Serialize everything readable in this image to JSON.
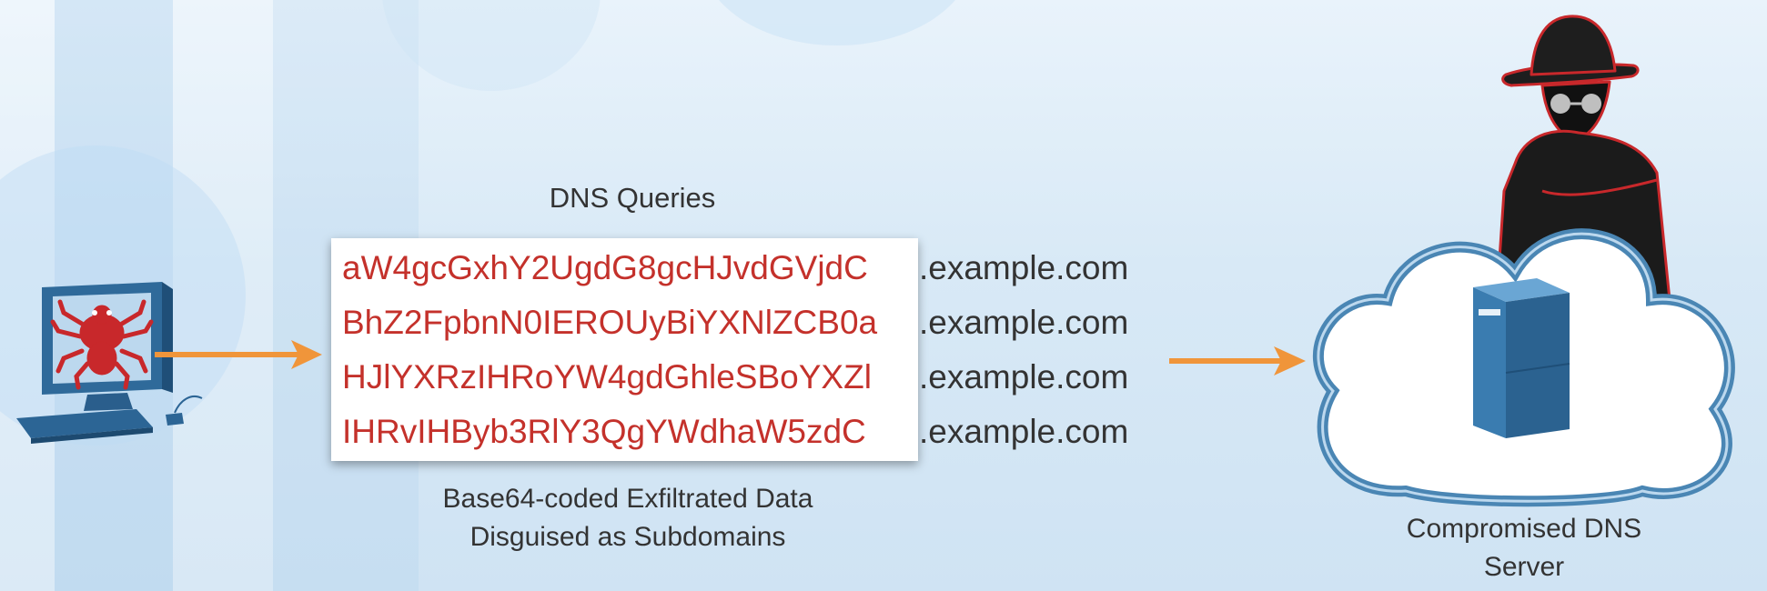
{
  "queries_title": "DNS Queries",
  "queries": [
    {
      "subdomain": "aW4gcGxhY2UgdG8gcHJvdGVjdC",
      "domain": ".example.com"
    },
    {
      "subdomain": "BhZ2FpbnN0IEROUyBiYXNlZCB0a",
      "domain": ".example.com"
    },
    {
      "subdomain": "HJlYXRzIHRoYW4gdGhleSBoYXZl",
      "domain": ".example.com"
    },
    {
      "subdomain": "IHRvIHByb3RlY3QgYWdhaW5zdC",
      "domain": ".example.com"
    }
  ],
  "data_caption": [
    "Base64-coded Exfiltrated Data",
    "Disguised as Subdomains"
  ],
  "server_caption": [
    "Compromised DNS",
    "Server"
  ],
  "colors": {
    "subdomain_text": "#c4312b",
    "arrow": "#f0953a",
    "cloud_outline": "#4a86b4",
    "server": "#3a7cb0",
    "virus": "#c8282b"
  },
  "icons": [
    "infected-computer-icon",
    "virus-icon",
    "hacker-icon",
    "cloud-icon",
    "server-icon"
  ]
}
